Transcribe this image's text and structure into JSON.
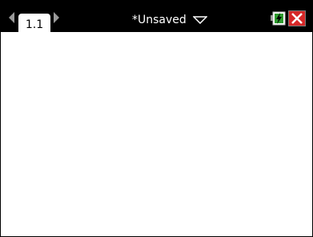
{
  "tabs": {
    "active_label": "1.1"
  },
  "document": {
    "title": "*Unsaved"
  },
  "icons": {
    "left": "chevron-left-icon",
    "right": "chevron-right-icon",
    "menu": "dropdown-triangle-icon",
    "battery": "battery-charging-icon",
    "close": "close-icon"
  },
  "colors": {
    "titlebar": "#000000",
    "battery_green": "#2e9a2e",
    "close_red": "#d62828"
  }
}
